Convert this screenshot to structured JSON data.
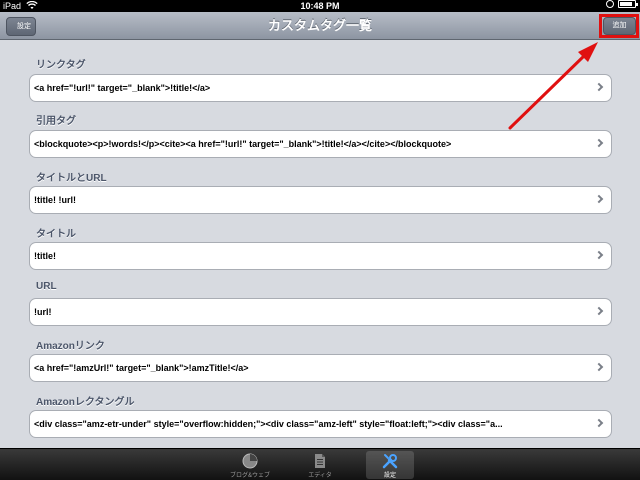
{
  "status_bar": {
    "device": "iPad",
    "time": "10:48 PM"
  },
  "nav": {
    "title": "カスタムタグ一覧",
    "back_label": "設定",
    "add_label": "追加"
  },
  "sections": [
    {
      "label": "リンクタグ",
      "value": "<a href=\"!url!\" target=\"_blank\">!title!</a>"
    },
    {
      "label": "引用タグ",
      "value": "<blockquote><p>!words!</p><cite><a href=\"!url!\" target=\"_blank\">!title!</a></cite></blockquote>"
    },
    {
      "label": "タイトルとURL",
      "value": "!title! !url!"
    },
    {
      "label": "タイトル",
      "value": "!title!"
    },
    {
      "label": "URL",
      "value": "!url!"
    },
    {
      "label": "Amazonリンク",
      "value": "<a href=\"!amzUrl!\" target=\"_blank\">!amzTitle!</a>"
    },
    {
      "label": "Amazonレクタングル",
      "value": "<div class=\"amz-etr-under\" style=\"overflow:hidden;\"><div class=\"amz-left\" style=\"float:left;\"><div class=\"a..."
    }
  ],
  "tab_bar": {
    "tabs": [
      {
        "label": "ブログ&ウェブ",
        "icon": "blog-web-icon"
      },
      {
        "label": "エディタ",
        "icon": "document-icon"
      },
      {
        "label": "設定",
        "icon": "tools-icon",
        "selected": true
      }
    ]
  },
  "annotation": {
    "highlight_color": "#e01010"
  }
}
